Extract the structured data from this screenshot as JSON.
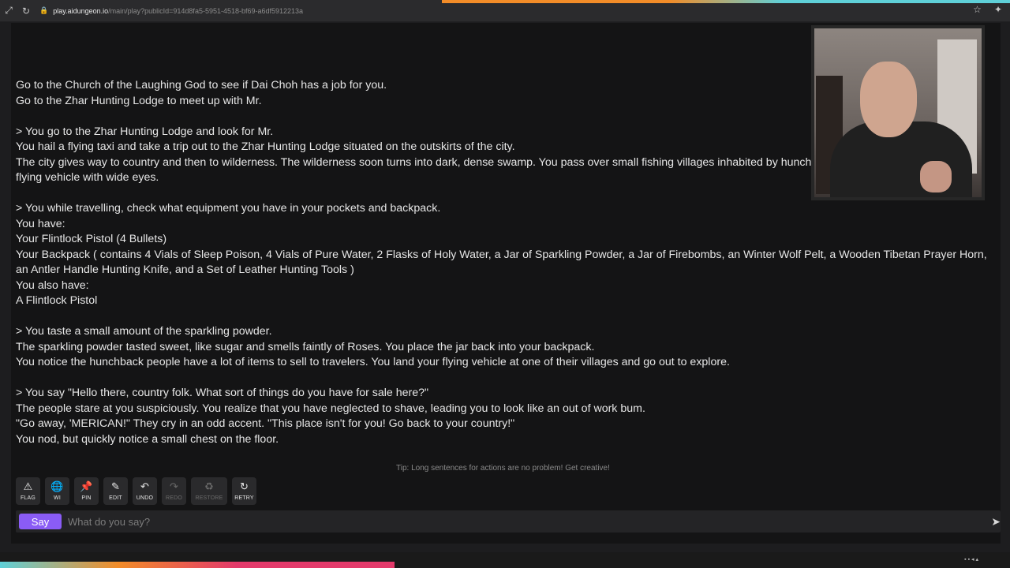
{
  "browser": {
    "url_host": "play.aidungeon.io",
    "url_path": "/main/play?publicId=914d8fa5-5951-4518-bf69-a6df5912213a"
  },
  "story": {
    "lines": [
      "Go to the Church of the Laughing God to see if Dai Choh has a job for you.",
      "Go to the Zhar Hunting Lodge to meet up with Mr.",
      "",
      "> You go to the Zhar Hunting Lodge and look for Mr.",
      "You hail a flying taxi and take a trip out to the Zhar Hunting Lodge situated on the outskirts of the city.",
      "The city gives way to country and then to wilderness. The wilderness soon turns into dark, dense swamp. You pass over small fishing villages inhabited by hunchbacked people who look up at your flying vehicle with wide eyes.",
      "",
      "> You while travelling, check what equipment you have in your pockets and backpack.",
      "You have:",
      "Your Flintlock Pistol (4 Bullets)",
      "Your Backpack ( contains 4 Vials of Sleep Poison, 4 Vials of Pure Water, 2 Flasks of Holy Water, a Jar of Sparkling Powder, a Jar of Firebombs, an Winter Wolf Pelt, a Wooden Tibetan Prayer Horn, an Antler Handle Hunting Knife, and a Set of Leather Hunting Tools )",
      "You also have:",
      "A Flintlock Pistol",
      "",
      "> You taste a small amount of the sparkling powder.",
      "The sparkling powder tasted sweet, like sugar and smells faintly of Roses. You place the jar back into your backpack.",
      "You notice the hunchback people have a lot of items to sell to travelers. You land your flying vehicle at one of their villages and go out to explore.",
      "",
      "> You say \"Hello there, country folk. What sort of things do you have for sale here?\"",
      "The people stare at you suspiciously. You realize that you have neglected to shave, leading you to look like an out of work bum.",
      "\"Go away, 'MERICAN!\" They cry in an odd accent. \"This place isn't for you! Go back to your country!\"",
      "You nod, but quickly notice a small chest on the floor."
    ]
  },
  "tip": "Tip: Long sentences for actions are no problem! Get creative!",
  "actions": [
    {
      "label": "FLAG",
      "icon": "warning-icon",
      "glyph": "⚠"
    },
    {
      "label": "WI",
      "icon": "globe-icon",
      "glyph": "🌐"
    },
    {
      "label": "PIN",
      "icon": "pin-icon",
      "glyph": "📌"
    },
    {
      "label": "EDIT",
      "icon": "pencil-icon",
      "glyph": "✎"
    },
    {
      "label": "UNDO",
      "icon": "undo-icon",
      "glyph": "↶"
    },
    {
      "label": "REDO",
      "icon": "redo-icon",
      "glyph": "↷"
    },
    {
      "label": "RESTORE",
      "icon": "recycle-icon",
      "glyph": "♻"
    },
    {
      "label": "RETRY",
      "icon": "retry-icon",
      "glyph": "↻"
    }
  ],
  "input": {
    "say_label": "Say",
    "placeholder": "What do you say?"
  },
  "colors": {
    "say_button": "#8a5cf6",
    "background": "#141415"
  }
}
